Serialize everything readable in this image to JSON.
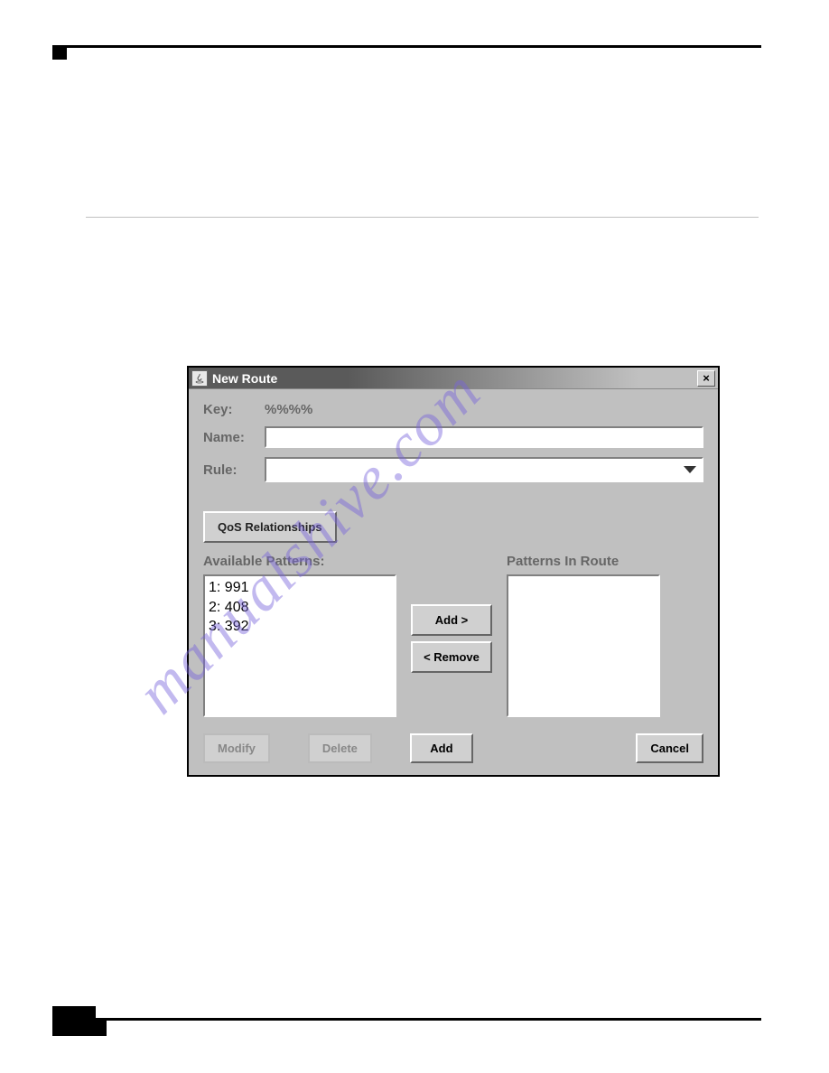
{
  "dialog": {
    "title": "New Route",
    "close_label": "×",
    "fields": {
      "key_label": "Key:",
      "key_value": "%%%%",
      "name_label": "Name:",
      "name_value": "",
      "rule_label": "Rule:",
      "rule_value": ""
    },
    "qos_button": "QoS Relationships",
    "available_title": "Available Patterns:",
    "available_patterns": [
      "1: 991",
      "2: 408",
      "3: 392"
    ],
    "inroute_title": "Patterns In Route",
    "buttons": {
      "add_move": "Add >",
      "remove_move": "< Remove",
      "modify": "Modify",
      "delete": "Delete",
      "add": "Add",
      "cancel": "Cancel"
    }
  },
  "watermark": "manualshive.com"
}
